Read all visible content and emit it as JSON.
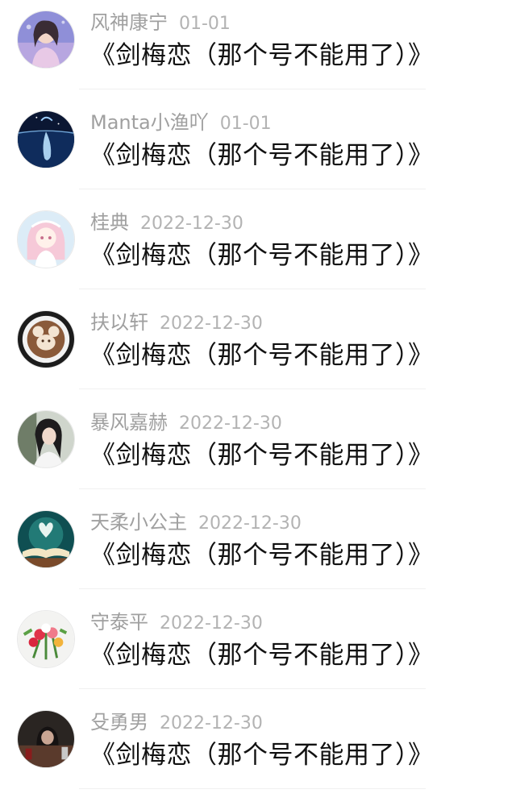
{
  "comments": [
    {
      "name": "风神康宁",
      "date": "01-01",
      "text": "《剑梅恋（那个号不能用了）》",
      "avatar": "avatar-girl-lavender"
    },
    {
      "name": "Manta小渔吖",
      "date": "01-01",
      "text": "《剑梅恋（那个号不能用了）》",
      "avatar": "avatar-whale-night"
    },
    {
      "name": "桂典",
      "date": "2022-12-30",
      "text": "《剑梅恋（那个号不能用了）》",
      "avatar": "avatar-anime-girl-pink"
    },
    {
      "name": "扶以轩",
      "date": "2022-12-30",
      "text": "《剑梅恋（那个号不能用了）》",
      "avatar": "avatar-latte-art"
    },
    {
      "name": "暴风嘉赫",
      "date": "2022-12-30",
      "text": "《剑梅恋（那个号不能用了）》",
      "avatar": "avatar-girl-photo"
    },
    {
      "name": "天柔小公主",
      "date": "2022-12-30",
      "text": "《剑梅恋（那个号不能用了）》",
      "avatar": "avatar-book-heart"
    },
    {
      "name": "守泰平",
      "date": "2022-12-30",
      "text": "《剑梅恋（那个号不能用了）》",
      "avatar": "avatar-flowers"
    },
    {
      "name": "殳勇男",
      "date": "2022-12-30",
      "text": "《剑梅恋（那个号不能用了）》",
      "avatar": "avatar-dark-photo"
    }
  ]
}
